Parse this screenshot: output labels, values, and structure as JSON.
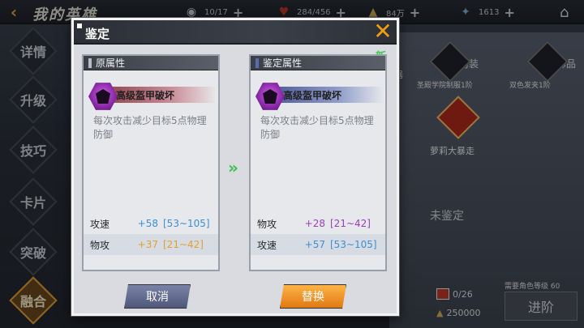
{
  "top_bar": {
    "title": "我的英雄",
    "resources": [
      {
        "icon": "eye-icon",
        "value": "10/17"
      },
      {
        "icon": "heart-icon",
        "value": "284/456"
      },
      {
        "icon": "gem-icon",
        "value": "84万"
      },
      {
        "icon": "star-icon",
        "value": "1613"
      }
    ]
  },
  "left_nav": {
    "items": [
      "详情",
      "升级",
      "技巧",
      "卡片",
      "突破",
      "融合"
    ],
    "active_index": 5
  },
  "background": {
    "skill_partial": "器",
    "skills": [
      {
        "title": "防装",
        "caption": "圣殿学院制服1阶"
      },
      {
        "title": "饰品",
        "caption": "双色发夹1阶"
      }
    ],
    "hero_skill": "萝莉大暴走",
    "unidentified": "未鉴定",
    "requirement": "需要角色等级 60",
    "cost_item": "0/26",
    "cost_gold": "250000",
    "advance_button": "进阶"
  },
  "modal": {
    "title": "鉴定",
    "close_icon": "close-icon",
    "new_badge": "新",
    "arrow": "»",
    "original": {
      "header": "原属性",
      "skill_name": "高级盔甲破坏",
      "skill_desc": "每次攻击减少目标5点物理防御",
      "stats": [
        {
          "name": "攻速",
          "value": "+58",
          "range": "[53~105]",
          "color": "#3d8fd0"
        },
        {
          "name": "物攻",
          "value": "+37",
          "range": "[21~42]",
          "color": "#e0a22e"
        }
      ]
    },
    "identified": {
      "header": "鉴定属性",
      "skill_name": "高级盔甲破坏",
      "skill_desc": "每次攻击减少目标5点物理防御",
      "stats": [
        {
          "name": "物攻",
          "value": "+28",
          "range": "[21~42]",
          "color": "#9b3fb5"
        },
        {
          "name": "攻速",
          "value": "+57",
          "range": "[53~105]",
          "color": "#3d8fd0"
        }
      ]
    },
    "buttons": {
      "cancel": "取消",
      "replace": "替换"
    }
  }
}
